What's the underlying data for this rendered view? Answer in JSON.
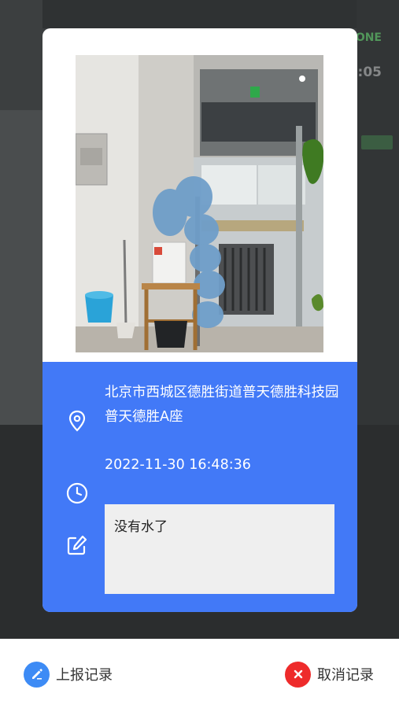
{
  "background": {
    "status_text": "ONE",
    "status_time": ":05"
  },
  "card": {
    "photo": {
      "description_icon": "photo-icon"
    },
    "location": {
      "icon": "location-pin-icon",
      "text": "北京市西城区德胜街道普天德胜科技园普天德胜A座"
    },
    "timestamp": {
      "icon": "clock-icon",
      "text": "2022-11-30 16:48:36"
    },
    "note": {
      "icon": "edit-icon",
      "text": "没有水了"
    },
    "accent_color": "#4279f7"
  },
  "bottom_bar": {
    "report_label": "上报记录",
    "report_icon": "pencil-icon",
    "report_color": "#3d8bf5",
    "cancel_label": "取消记录",
    "cancel_icon": "close-icon",
    "cancel_color": "#ee2b2b"
  }
}
